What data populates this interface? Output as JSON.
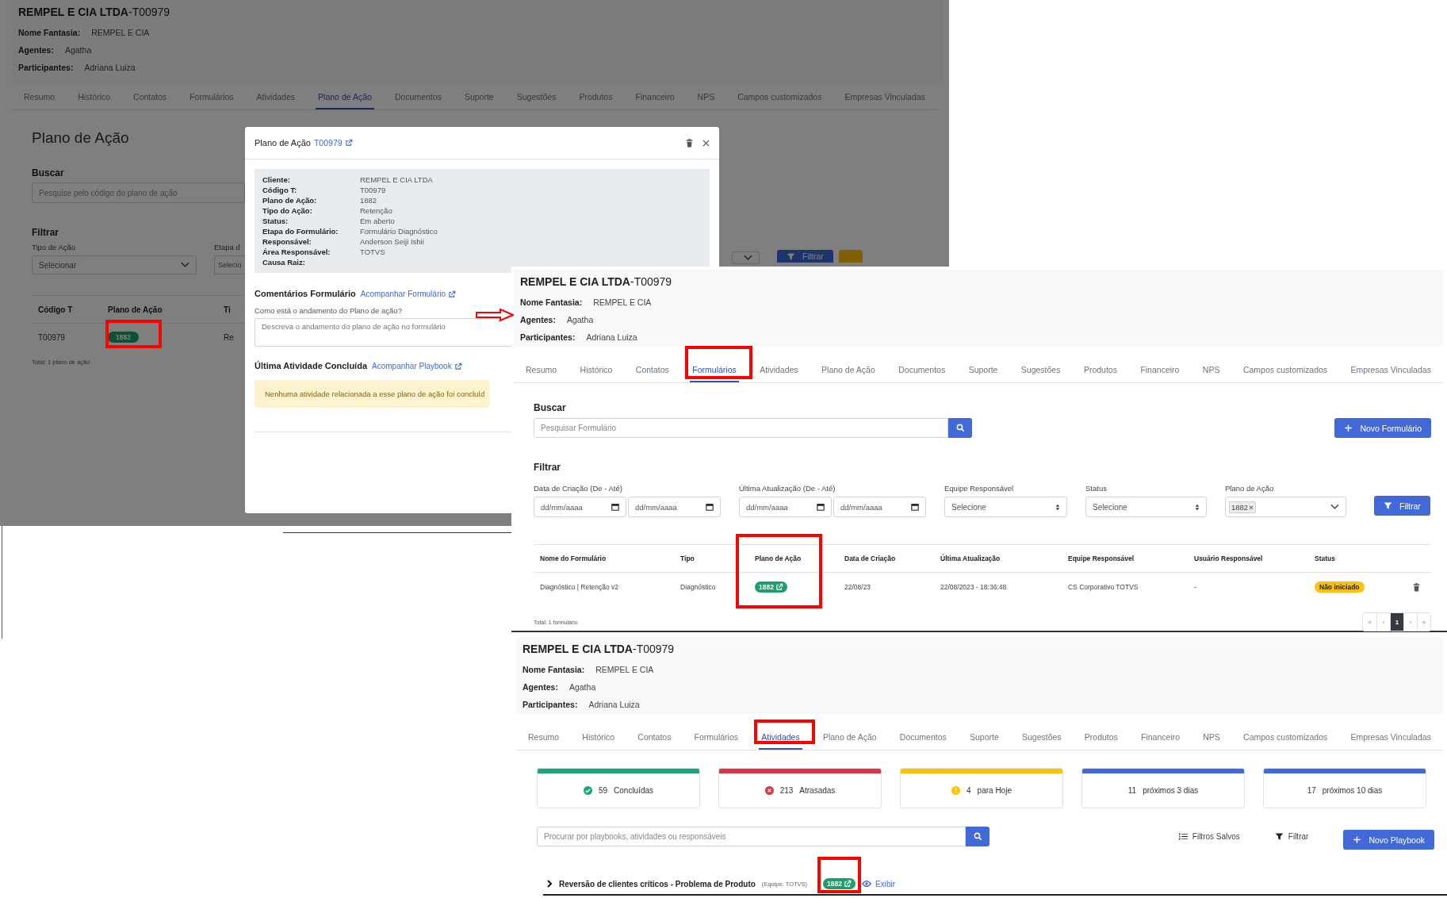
{
  "plano_view": {
    "header": {
      "company": "REMPEL E CIA LTDA",
      "code": "-T00979",
      "fields": [
        {
          "label": "Nome Fantasia:",
          "value": "REMPEL E CIA"
        },
        {
          "label": "Agentes:",
          "value": "Agatha"
        },
        {
          "label": "Participantes:",
          "value": "Adriana Luiza"
        }
      ]
    },
    "tabs": [
      {
        "label": "Resumo",
        "selected": false
      },
      {
        "label": "Histórico",
        "selected": false
      },
      {
        "label": "Contatos",
        "selected": false
      },
      {
        "label": "Formulários",
        "selected": false
      },
      {
        "label": "Atividades",
        "selected": false
      },
      {
        "label": "Plano de Ação",
        "selected": true
      },
      {
        "label": "Documentos",
        "selected": false
      },
      {
        "label": "Suporte",
        "selected": false
      },
      {
        "label": "Sugestões",
        "selected": false
      },
      {
        "label": "Produtos",
        "selected": false
      },
      {
        "label": "Financeiro",
        "selected": false
      },
      {
        "label": "NPS",
        "selected": false
      },
      {
        "label": "Campos customizados",
        "selected": false
      },
      {
        "label": "Empresas Vinculadas",
        "selected": false
      }
    ],
    "page_title": "Plano de Ação",
    "search": {
      "label": "Buscar",
      "placeholder": "Pesquise pelo código do plano de ação"
    },
    "filter": {
      "label": "Filtrar",
      "fields": [
        {
          "label": "Tipo de Ação",
          "value": "Selecionar"
        },
        {
          "label": "Etapa d",
          "value": "Selecio"
        }
      ],
      "button": "Filtrar"
    },
    "table": {
      "columns": [
        "Código T",
        "Plano de Ação",
        "Ti"
      ],
      "rows": [
        {
          "codigo": "T00979",
          "plano": "1882",
          "column_3": "Re"
        }
      ]
    },
    "total": "Total: 1 plano de ação",
    "modal": {
      "title": "Plano de Ação",
      "code_link": "T00979",
      "details": [
        {
          "label": "Cliente:",
          "value": "REMPEL E CIA LTDA"
        },
        {
          "label": "Código T:",
          "value": "T00979"
        },
        {
          "label": "Plano de Ação:",
          "value": "1882"
        },
        {
          "label": "Tipo do Ação:",
          "value": "Retenção"
        },
        {
          "label": "Status:",
          "value": "Em aberto"
        },
        {
          "label": "Etapa do Formulário:",
          "value": "Formulário Diagnóstico"
        },
        {
          "label": "Responsável:",
          "value": "Anderson Seiji Ishii"
        },
        {
          "label": "Área Responsável:",
          "value": "TOTVS"
        },
        {
          "label": "Causa Raiz:"
        }
      ],
      "comments": {
        "title": "Comentários Formulário",
        "link": "Acompanhar Formulário",
        "question": "Como está o andamento do Plano de ação?",
        "placeholder": "Descreva o andamento do plano de ação no formulário"
      },
      "last_activity": {
        "title": "Última Atividade Concluída",
        "link": "Acompanhar Playbook",
        "alert": "Nenhuma atividade relacionada a esse plano de ação foi concluíd"
      }
    }
  },
  "formularios_view": {
    "header": {
      "company": "REMPEL E CIA LTDA",
      "code": "-T00979",
      "fields": [
        {
          "label": "Nome Fantasia:",
          "value": "REMPEL E CIA"
        },
        {
          "label": "Agentes:",
          "value": "Agatha"
        },
        {
          "label": "Participantes:",
          "value": "Adriana Luiza"
        }
      ]
    },
    "tabs": [
      {
        "label": "Resumo",
        "selected": false
      },
      {
        "label": "Histórico",
        "selected": false
      },
      {
        "label": "Contatos",
        "selected": false
      },
      {
        "label": "Formulários",
        "selected": true
      },
      {
        "label": "Atividades",
        "selected": false
      },
      {
        "label": "Plano de Ação",
        "selected": false
      },
      {
        "label": "Documentos",
        "selected": false
      },
      {
        "label": "Suporte",
        "selected": false
      },
      {
        "label": "Sugestões",
        "selected": false
      },
      {
        "label": "Produtos",
        "selected": false
      },
      {
        "label": "Financeiro",
        "selected": false
      },
      {
        "label": "NPS",
        "selected": false
      },
      {
        "label": "Campos customizados",
        "selected": false
      },
      {
        "label": "Empresas Vinculadas",
        "selected": false
      }
    ],
    "search": {
      "label": "Buscar",
      "placeholder": "Pesquisar Formulário"
    },
    "new_button": "Novo Formulário",
    "filter": {
      "label": "Filtrar",
      "groups": [
        {
          "kind": "date_range",
          "label": "Data de Criação (De - Até)",
          "placeholders": [
            "dd/mm/aaaa",
            "dd/mm/aaaa"
          ]
        },
        {
          "kind": "date_range",
          "label": "Última Atualização (De - Até)",
          "placeholders": [
            "dd/mm/aaaa",
            "dd/mm/aaaa"
          ]
        },
        {
          "kind": "select",
          "label": "Equipe Responsável",
          "value": "Selecione"
        },
        {
          "kind": "select",
          "label": "Status",
          "value": "Selecione"
        },
        {
          "kind": "tags",
          "label": "Plano de Ação",
          "tags": [
            {
              "label": "1882",
              "remove": "×"
            }
          ]
        }
      ],
      "button": "Filtrar"
    },
    "table": {
      "columns": [
        "Nome do Formulário",
        "Tipo",
        "Plano de Ação",
        "Data de Criação",
        "Última Atualização",
        "Equipe Responsável",
        "Usuário Responsável",
        "Status"
      ],
      "rows": [
        {
          "nome": "Diagnóstico | Retenção v2",
          "tipo": "Diagnóstico",
          "plano": "1882",
          "data": "22/08/23",
          "atualizacao": "22/08/2023 - 18:36:48",
          "equipe": "CS Corporativo TOTVS",
          "usuario": "-",
          "status": "Não iniciado"
        }
      ]
    },
    "total": "Total: 1 formulário",
    "pagination": [
      {
        "label": "«",
        "selected": false
      },
      {
        "label": "‹",
        "selected": false
      },
      {
        "label": "1",
        "selected": true
      },
      {
        "label": "›",
        "selected": false
      },
      {
        "label": "»",
        "selected": false
      }
    ]
  },
  "atividades_view": {
    "header": {
      "company": "REMPEL E CIA LTDA",
      "code": "-T00979",
      "fields": [
        {
          "label": "Nome Fantasia:",
          "value": "REMPEL E CIA"
        },
        {
          "label": "Agentes:",
          "value": "Agatha"
        },
        {
          "label": "Participantes:",
          "value": "Adriana Luiza"
        }
      ]
    },
    "tabs": [
      {
        "label": "Resumo",
        "selected": false
      },
      {
        "label": "Histórico",
        "selected": false
      },
      {
        "label": "Contatos",
        "selected": false
      },
      {
        "label": "Formulários",
        "selected": false
      },
      {
        "label": "Atividades",
        "selected": true
      },
      {
        "label": "Plano de Ação",
        "selected": false
      },
      {
        "label": "Documentos",
        "selected": false
      },
      {
        "label": "Suporte",
        "selected": false
      },
      {
        "label": "Sugestões",
        "selected": false
      },
      {
        "label": "Produtos",
        "selected": false
      },
      {
        "label": "Financeiro",
        "selected": false
      },
      {
        "label": "NPS",
        "selected": false
      },
      {
        "label": "Campos customizados",
        "selected": false
      },
      {
        "label": "Empresas Vinculadas",
        "selected": false
      }
    ],
    "cards": [
      {
        "kind": "done",
        "count": "59",
        "label": "Concluídas",
        "color": "#1fa37a"
      },
      {
        "kind": "late",
        "count": "213",
        "label": "Atrasadas",
        "color": "#dc3545"
      },
      {
        "kind": "today",
        "count": "4",
        "label": "para Hoje",
        "color": "#ffc107"
      },
      {
        "kind": "upcoming",
        "count": "11",
        "label": "próximos 3 dias",
        "color": "#3f6ad8"
      },
      {
        "kind": "upcoming",
        "count": "17",
        "label": "próximos 10 dias",
        "color": "#3f6ad8"
      }
    ],
    "search": {
      "placeholder": "Procurar por playbooks, atividades ou responsáveis"
    },
    "saved_filters": "Filtros Salvos",
    "filter_button": "Filtrar",
    "new_button": "Novo Playbook",
    "playbook": {
      "title": "Reversão de clientes críticos - Problema de Produto",
      "team": "(Equipe: TOTVS)",
      "badge": "1882",
      "action": "Exibir"
    }
  }
}
